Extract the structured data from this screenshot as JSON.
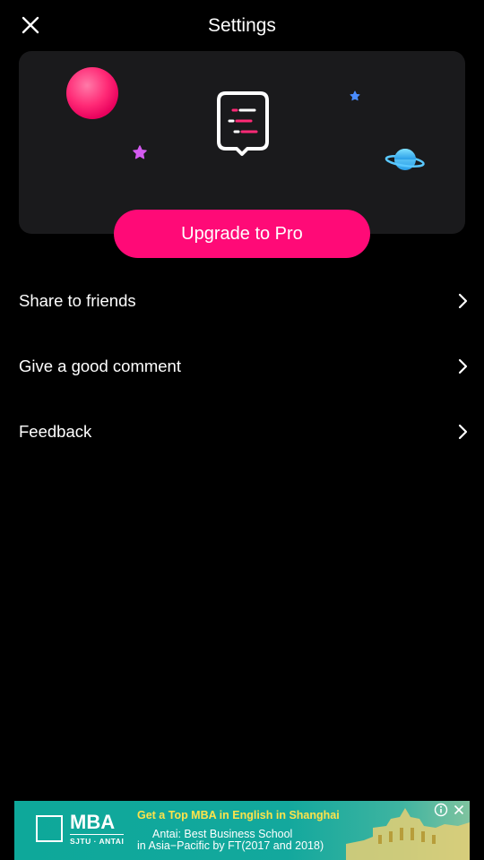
{
  "header": {
    "title": "Settings",
    "close_icon": "close-icon"
  },
  "promo": {
    "upgrade_label": "Upgrade to Pro",
    "icon": "chat-list-icon",
    "decorations": [
      "pink-sphere",
      "purple-star",
      "blue-star",
      "saturn-planet"
    ]
  },
  "menu": {
    "items": [
      {
        "label": "Share to friends",
        "icon": "chevron-right-icon"
      },
      {
        "label": "Give a good comment",
        "icon": "chevron-right-icon"
      },
      {
        "label": "Feedback",
        "icon": "chevron-right-icon"
      }
    ]
  },
  "ad": {
    "logo_text": "MBA",
    "logo_sub": "SJTU · ANTAI",
    "headline": "Get a Top MBA in English in Shanghai",
    "line2": "Antai: Best Business School",
    "line3": "in Asia−Pacific by FT(2017 and 2018)",
    "info_icon": "info-icon",
    "close_icon": "close-icon"
  },
  "colors": {
    "background": "#000000",
    "card": "#1a1a1c",
    "accent": "#ff0a77",
    "ad_bg": "#13a89d",
    "ad_headline": "#ffe34a"
  }
}
